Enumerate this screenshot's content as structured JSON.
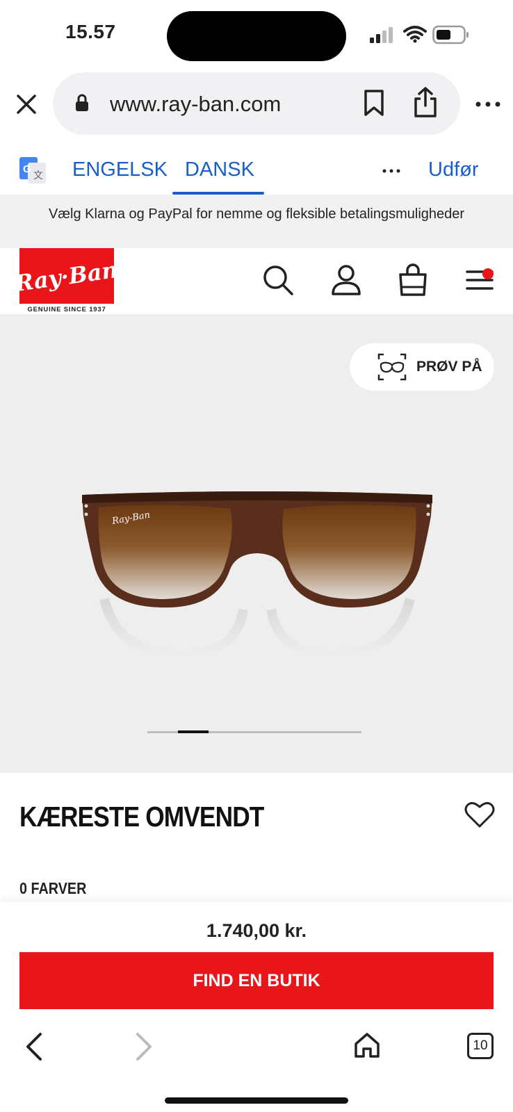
{
  "status_bar": {
    "time": "15.57"
  },
  "browser": {
    "url": "www.ray-ban.com",
    "tab_count": "10"
  },
  "translate_bar": {
    "tab_english": "ENGELSK",
    "tab_danish": "DANSK",
    "action": "Udfør"
  },
  "promo_banner": {
    "text": "Vælg Klarna og PayPal for nemme og fleksible betalingsmuligheder"
  },
  "header": {
    "logo_text": "Ray-Ban",
    "logo_tagline": "GENUINE SINCE 1937",
    "icons": [
      "search-icon",
      "account-icon",
      "bag-icon",
      "menu-icon"
    ],
    "menu_has_notification": true
  },
  "hero": {
    "try_on_label": "PRØV PÅ",
    "carousel_total": 7,
    "carousel_active_index": 1
  },
  "product": {
    "title": "KÆRESTE OMVENDT",
    "colors_label": "0 FARVER",
    "price": "1.740,00 kr.",
    "cta_label": "FIND EN BUTIK"
  },
  "colors": {
    "brand_red": "#e8151b",
    "link_blue": "#1a5fc8"
  }
}
